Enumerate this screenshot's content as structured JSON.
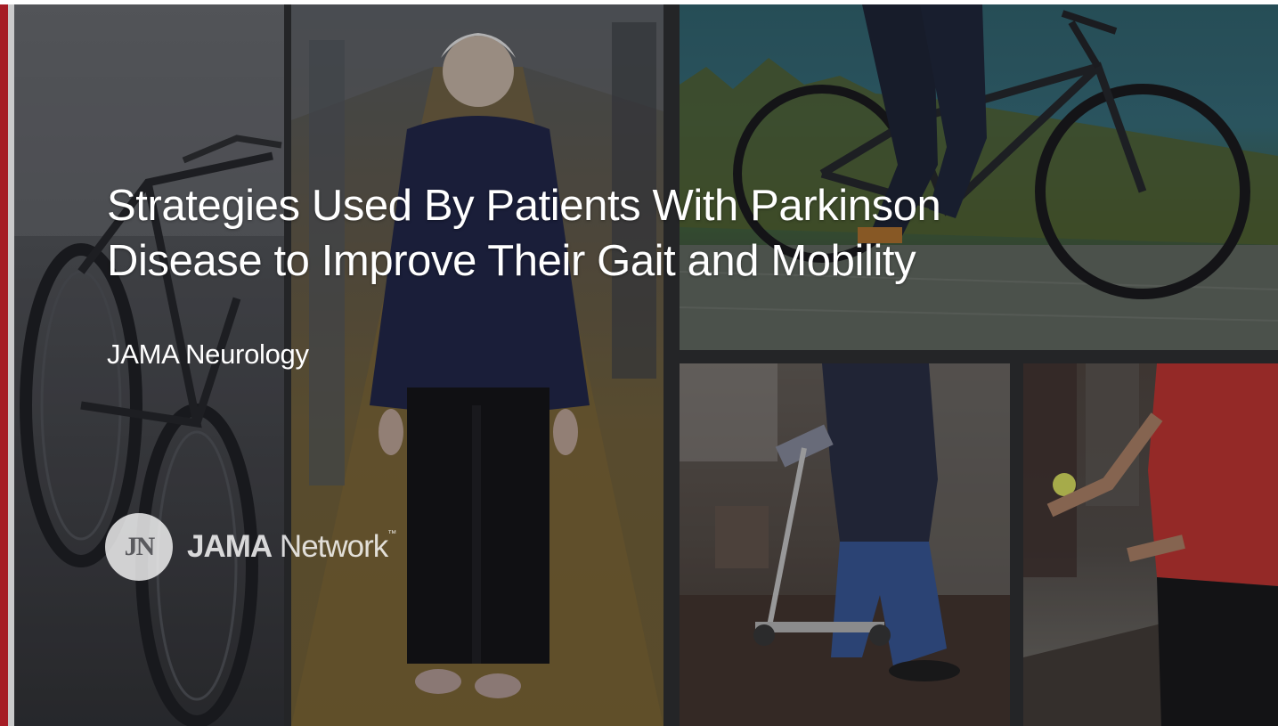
{
  "slide": {
    "title_line1": "Strategies Used By Patients With Parkinson",
    "title_line2": "Disease to Improve Their Gait and Mobility",
    "journal": "JAMA Neurology",
    "logo_mark": "JN",
    "logo_brand": "JAMA",
    "logo_network": "Network",
    "logo_tm": "™"
  },
  "colors": {
    "accent": "#c8202a",
    "title_text": "#ffffff"
  },
  "icons": {
    "logo": "jama-network-logo-icon"
  }
}
